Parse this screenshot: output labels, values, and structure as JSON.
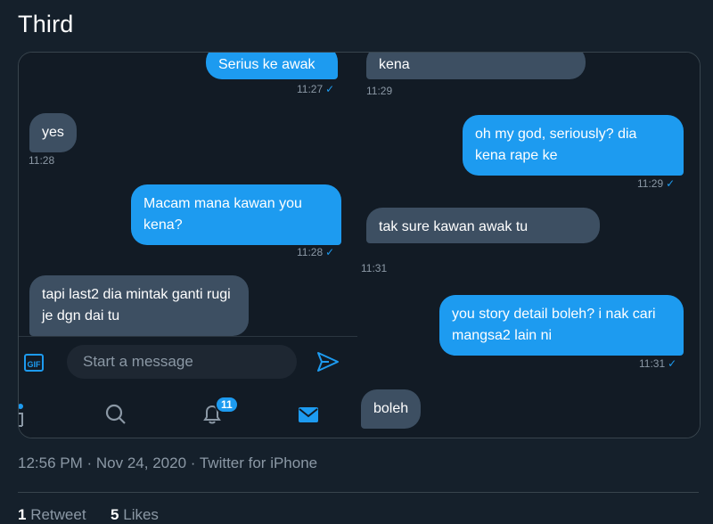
{
  "tweet": {
    "text": "Third"
  },
  "left_panel": {
    "messages": [
      {
        "text": "Serius ke awak",
        "time": "11:27"
      },
      {
        "text": "yes",
        "time": "11:28"
      },
      {
        "text": "Macam mana kawan you kena?",
        "time": "11:28"
      },
      {
        "text": "tapi last2 dia mintak ganti rugi je dgn dai tu"
      }
    ],
    "composer": {
      "placeholder": "Start a message",
      "gif_label": "GIF"
    },
    "nav": {
      "notifications_badge": "11"
    }
  },
  "right_panel": {
    "messages": [
      {
        "text": "kena",
        "time": "11:29"
      },
      {
        "text": "oh my god, seriously? dia kena rape ke",
        "time": "11:29"
      },
      {
        "text": "tak sure kawan awak tu",
        "time": "11:31"
      },
      {
        "text": "you story detail boleh? i nak cari mangsa2 lain ni",
        "time": "11:31"
      },
      {
        "text": "boleh"
      }
    ]
  },
  "meta": {
    "time": "12:56 PM",
    "date": "Nov 24, 2020",
    "source": "Twitter for iPhone"
  },
  "stats": {
    "retweets": "1",
    "retweets_label": "Retweet",
    "likes": "5",
    "likes_label": "Likes"
  },
  "icons": [
    "gif-icon",
    "send-icon",
    "person-icon",
    "search-icon",
    "bell-icon",
    "mail-icon"
  ],
  "colors": {
    "background": "#15202b",
    "accent": "#1d9bf0",
    "incoming_bubble": "#3d4f62"
  }
}
